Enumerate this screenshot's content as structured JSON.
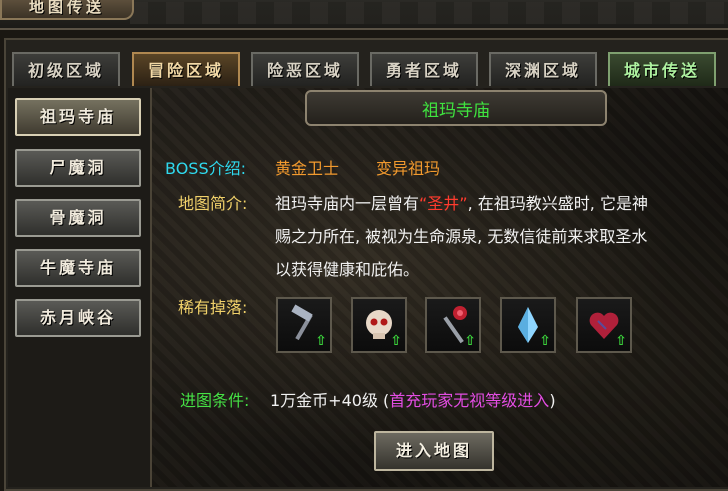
{
  "window_title": "地图传送",
  "tabs": [
    "初级区域",
    "冒险区域",
    "险恶区域",
    "勇者区域",
    "深渊区域",
    "城市传送"
  ],
  "nav": [
    "祖玛寺庙",
    "尸魔洞",
    "骨魔洞",
    "牛魔寺庙",
    "赤月峡谷"
  ],
  "map": {
    "title": "祖玛寺庙",
    "boss_label": "BOSS介绍:",
    "bosses": [
      "黄金卫士",
      "变异祖玛"
    ],
    "intro_label": "地图简介:",
    "intro_line1_pre": "祖玛寺庙内一层曾有",
    "intro_highlight": "“圣井”",
    "intro_line1_post": ", 在祖玛教兴盛时, 它是神",
    "intro_line2": "赐之力所在, 被视为生命源泉, 无数信徒前来求取圣水",
    "intro_line3": "以获得健康和庇佑。",
    "drops_label": "稀有掉落:",
    "drops": [
      "hammer-item-icon",
      "skull-item-icon",
      "mace-item-icon",
      "crystal-item-icon",
      "heart-item-icon"
    ],
    "entry_label": "进图条件:",
    "entry_value": "1万金币+40级",
    "entry_open": "(",
    "entry_note": "首充玩家无视等级进入",
    "entry_close": ")"
  },
  "enter_button": "进入地图",
  "colors": {
    "title_green": "#3fe43f",
    "label_cyan": "#2fd9ee",
    "boss_orange": "#f29a2e",
    "highlight_red": "#ff3b2e",
    "note_magenta": "#e34de3"
  }
}
